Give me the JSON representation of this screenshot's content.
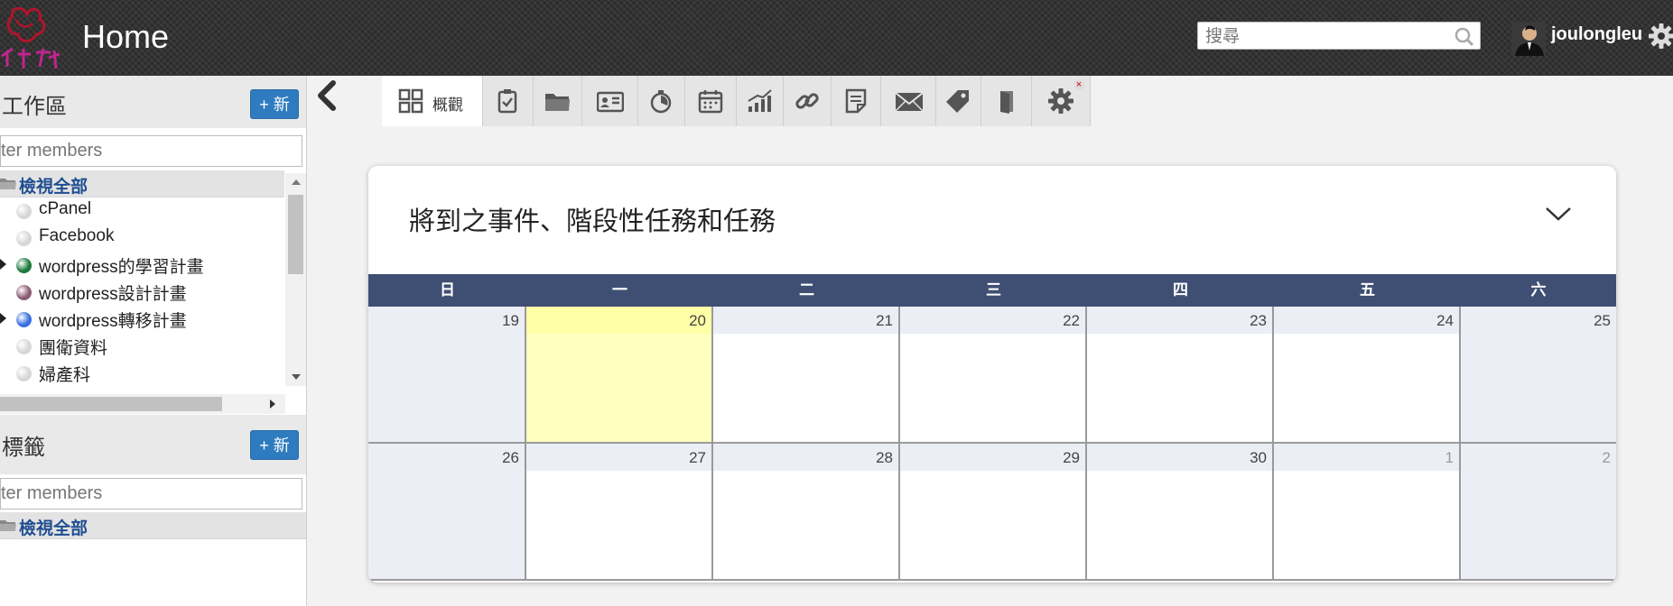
{
  "header": {
    "title": "Home",
    "search_placeholder": "搜尋",
    "username": "joulongleu",
    "icons": [
      "logo",
      "search-icon",
      "avatar",
      "gear-icon"
    ]
  },
  "sidebar": {
    "workspaces": {
      "title": "工作區",
      "new_label": "+ 新",
      "filter_placeholder": "ter members",
      "view_all": "檢視全部",
      "items": [
        {
          "label": "cPanel",
          "color": "#d6d6d6",
          "has_children": false
        },
        {
          "label": "Facebook",
          "color": "#d6d6d6",
          "has_children": false
        },
        {
          "label": "wordpress的學習計畫",
          "color": "#1e7a3c",
          "has_children": true
        },
        {
          "label": "wordpress設計計畫",
          "color": "#8a5a72",
          "has_children": false
        },
        {
          "label": "wordpress轉移計畫",
          "color": "#3a6fe0",
          "has_children": true
        },
        {
          "label": "團衛資料",
          "color": "#d6d6d6",
          "has_children": false
        },
        {
          "label": "婦產科",
          "color": "#d6d6d6",
          "has_children": false
        }
      ]
    },
    "tags": {
      "title": "標籤",
      "new_label": "+ 新",
      "filter_placeholder": "ter members",
      "view_all": "檢視全部"
    }
  },
  "tabs": [
    {
      "label": "概觀",
      "icon": "overview-grid-icon",
      "active": true
    },
    {
      "label": "",
      "icon": "tasks-clipboard-icon"
    },
    {
      "label": "",
      "icon": "documents-folder-icon"
    },
    {
      "label": "",
      "icon": "contacts-card-icon"
    },
    {
      "label": "",
      "icon": "time-stopwatch-icon"
    },
    {
      "label": "",
      "icon": "calendar-icon"
    },
    {
      "label": "",
      "icon": "reports-chart-icon"
    },
    {
      "label": "",
      "icon": "links-icon"
    },
    {
      "label": "",
      "icon": "notes-icon"
    },
    {
      "label": "",
      "icon": "mail-icon"
    },
    {
      "label": "",
      "icon": "tag-icon"
    },
    {
      "label": "",
      "icon": "door-icon"
    },
    {
      "label": "",
      "icon": "settings-gear-icon",
      "closable": true
    }
  ],
  "main": {
    "widget_title": "將到之事件、階段性任務和任務",
    "calendar": {
      "weekdays": [
        "日",
        "一",
        "二",
        "三",
        "四",
        "五",
        "六"
      ],
      "weeks": [
        [
          {
            "day": "19",
            "other": false,
            "today": false
          },
          {
            "day": "20",
            "other": false,
            "today": true
          },
          {
            "day": "21",
            "other": false,
            "today": false
          },
          {
            "day": "22",
            "other": false,
            "today": false
          },
          {
            "day": "23",
            "other": false,
            "today": false
          },
          {
            "day": "24",
            "other": false,
            "today": false
          },
          {
            "day": "25",
            "other": false,
            "today": false
          }
        ],
        [
          {
            "day": "26",
            "other": false,
            "today": false
          },
          {
            "day": "27",
            "other": false,
            "today": false
          },
          {
            "day": "28",
            "other": false,
            "today": false
          },
          {
            "day": "29",
            "other": false,
            "today": false
          },
          {
            "day": "30",
            "other": false,
            "today": false
          },
          {
            "day": "1",
            "other": true,
            "today": false
          },
          {
            "day": "2",
            "other": true,
            "today": false
          }
        ]
      ]
    }
  },
  "colors": {
    "header_bg": "#333333",
    "calendar_header": "#3f4f74",
    "today_bg": "#ffffc0",
    "weekend_bg": "#eceef6",
    "new_button": "#2f7bc0",
    "link_text": "#1f4e92"
  }
}
